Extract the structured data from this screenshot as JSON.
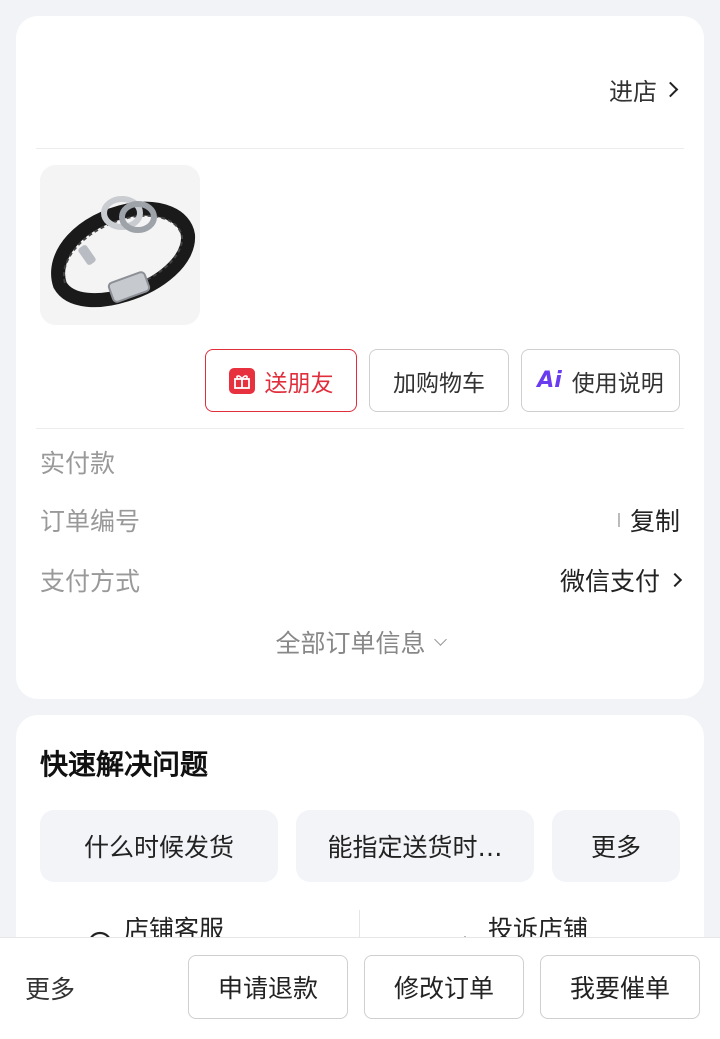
{
  "order_card": {
    "enter_shop_label": "进店",
    "actions": {
      "gift_label": "送朋友",
      "cart_label": "加购物车",
      "manual_label": "使用说明"
    },
    "info": {
      "paid_label": "实付款",
      "order_no_label": "订单编号",
      "copy_label": "复制",
      "pay_method_label": "支付方式",
      "pay_method_value": "微信支付"
    },
    "all_info_label": "全部订单信息"
  },
  "quick_card": {
    "title": "快速解决问题",
    "chips": [
      "什么时候发货",
      "能指定送货时…",
      "更多"
    ],
    "services": [
      "店铺客服",
      "投诉店铺"
    ]
  },
  "bottom_bar": {
    "more_label": "更多",
    "buttons": [
      "申请退款",
      "修改订单",
      "我要催单"
    ]
  },
  "colors": {
    "accent_red": "#e02e3c",
    "ai_purple": "#6a3cf0",
    "page_bg": "#f2f3f7"
  }
}
